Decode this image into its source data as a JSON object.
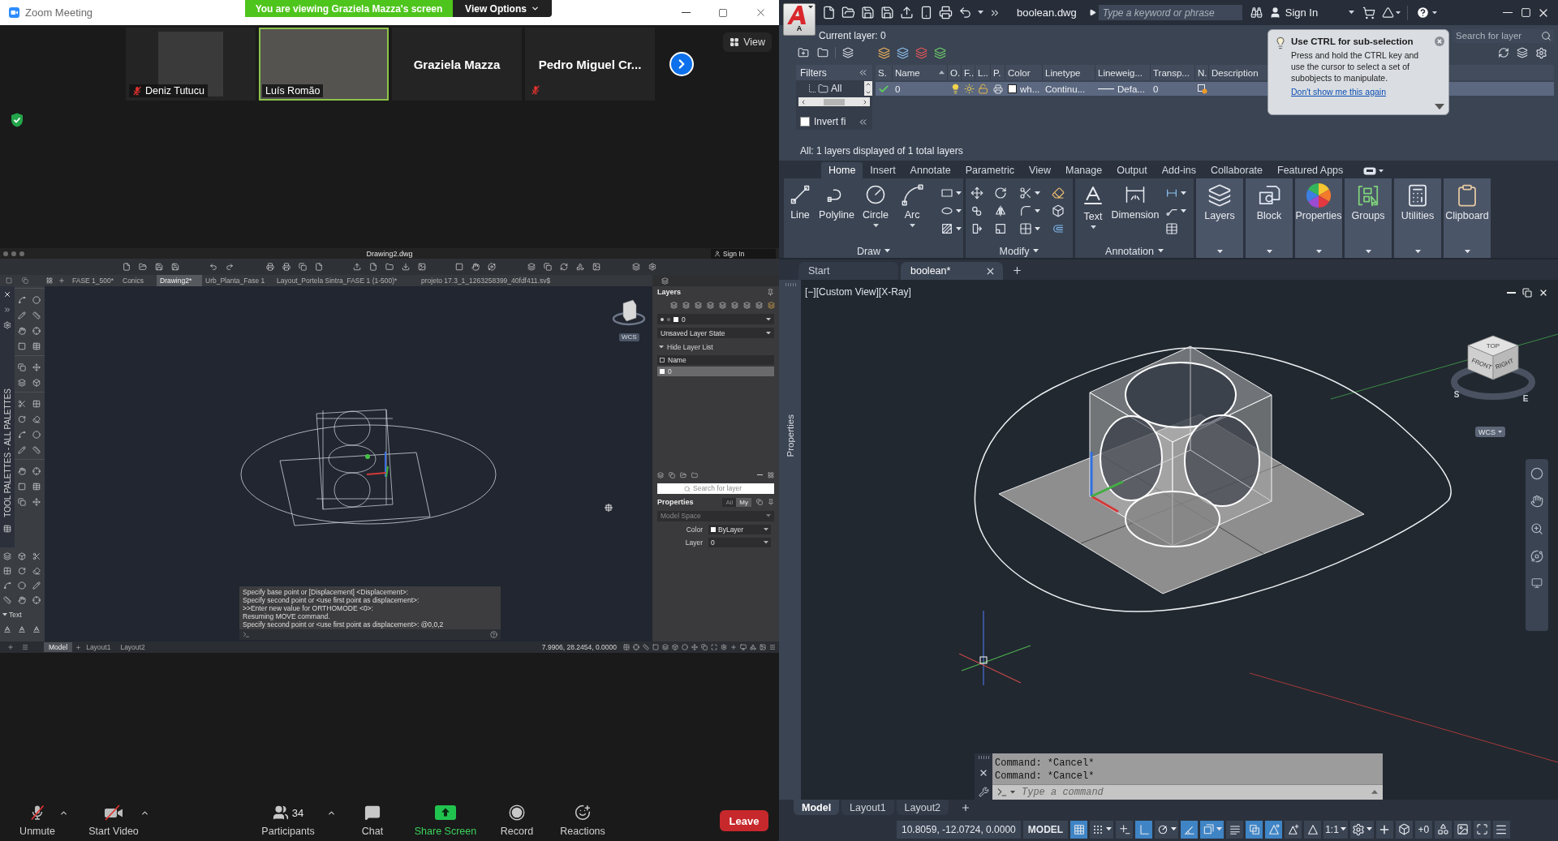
{
  "zoom": {
    "title": "Zoom Meeting",
    "banner": "You are viewing Graziela Mazza's screen",
    "view_options": "View Options",
    "participants": [
      {
        "name": "Deniz Tutucu",
        "kind": "picture",
        "muted": true,
        "speaking": false
      },
      {
        "name": "Luís Romão",
        "kind": "video",
        "muted": false,
        "speaking": true
      },
      {
        "name": "Graziela Mazza",
        "kind": "name",
        "muted": false,
        "speaking": false
      },
      {
        "name": "Pedro Miguel Cr...",
        "kind": "name",
        "muted": true,
        "speaking": false
      }
    ],
    "view_button": "View",
    "shared_screen": {
      "title": "Drawing2.dwg",
      "sign_in": "Sign In",
      "file_tabs": [
        {
          "label": "FASE 1_500*",
          "selected": false
        },
        {
          "label": "Conics",
          "selected": false
        },
        {
          "label": "Drawing2*",
          "selected": true
        },
        {
          "label": "Urb_Planta_Fase 1",
          "selected": false
        },
        {
          "label": "Layout_Portela Sintra_FASE 1 (1-500)*",
          "selected": false
        },
        {
          "label": "projeto 17.3_1_1263258399_40fdf411.sv$",
          "selected": false
        }
      ],
      "palette_title": "TOOL PALETTES - ALL PALETTES",
      "palette_section": "Text",
      "layers_panel": {
        "title": "Layers",
        "current_layer": "0",
        "layer_state": "Unsaved Layer State",
        "hide_list": "Hide Layer List",
        "name_column": "Name",
        "rows": [
          {
            "name": "0",
            "selected": true
          }
        ],
        "search_placeholder": "Search for layer"
      },
      "properties_panel": {
        "title": "Properties",
        "tabs": [
          {
            "label": "All",
            "selected": false
          },
          {
            "label": "My",
            "selected": true
          }
        ],
        "context": "Model Space",
        "rows": [
          {
            "label": "Color",
            "value": "ByLayer",
            "kind": "color"
          },
          {
            "label": "Layer",
            "value": "0",
            "kind": "text"
          }
        ]
      },
      "wcs": "WCS",
      "command_history": [
        "Specify base point or [Displacement] <Displacement>:",
        "Specify second point or <use first point as displacement>:",
        ">>Enter new value for ORTHOMODE <0>:",
        "Resuming MOVE command.",
        "Specify second point or <use first point as displacement>: @0,0,2"
      ],
      "layout_tabs": [
        {
          "label": "Model",
          "selected": true
        },
        {
          "label": "Layout1",
          "selected": false
        },
        {
          "label": "Layout2",
          "selected": false
        }
      ],
      "coordinates": "7.9906, 28.2454, 0.0000"
    },
    "toolbar": [
      {
        "kind": "mute",
        "label": "Unmute",
        "menu": true
      },
      {
        "kind": "video",
        "label": "Start Video",
        "menu": true
      },
      {
        "kind": "participants",
        "label": "Participants",
        "count": "34",
        "menu": true
      },
      {
        "kind": "chat",
        "label": "Chat",
        "menu": false
      },
      {
        "kind": "share",
        "label": "Share Screen",
        "menu": false
      },
      {
        "kind": "record",
        "label": "Record",
        "menu": false
      },
      {
        "kind": "reactions",
        "label": "Reactions",
        "menu": false
      }
    ],
    "leave": "Leave"
  },
  "autocad": {
    "app_menu_label": "A",
    "file_name": "boolean.dwg",
    "search_placeholder": "Type a keyword or phrase",
    "sign_in": "Sign In",
    "layer_manager": {
      "current_layer": "Current layer: 0",
      "search_placeholder": "Search for layer",
      "filters_title": "Filters",
      "filters": [
        "All"
      ],
      "invert_filter": {
        "label": "Invert fi",
        "checked": false
      },
      "columns": [
        "S.",
        "Name",
        "O.",
        "F..",
        "L..",
        "P.",
        "Color",
        "Linetype",
        "Lineweig...",
        "Transp...",
        "N.",
        "Description"
      ],
      "rows": [
        {
          "current": true,
          "name": "0",
          "on": true,
          "frozen": false,
          "locked": false,
          "color": "#ffffff",
          "color_name": "wh...",
          "linetype": "Continu...",
          "lineweight": "Defa...",
          "transparency": "0",
          "selected": true
        }
      ],
      "summary": "All: 1 layers displayed of 1 total layers"
    },
    "tooltip": {
      "title": "Use CTRL for sub-selection",
      "body": "Press and hold the CTRL key and use the cursor to select a set of subobjects to manipulate.",
      "link": "Don't show me this again"
    },
    "ribbon_tabs": [
      {
        "label": "Home",
        "selected": true
      },
      {
        "label": "Insert",
        "selected": false
      },
      {
        "label": "Annotate",
        "selected": false
      },
      {
        "label": "Parametric",
        "selected": false
      },
      {
        "label": "View",
        "selected": false
      },
      {
        "label": "Manage",
        "selected": false
      },
      {
        "label": "Output",
        "selected": false
      },
      {
        "label": "Add-ins",
        "selected": false
      },
      {
        "label": "Collaborate",
        "selected": false
      },
      {
        "label": "Featured Apps",
        "selected": false
      }
    ],
    "ribbon_panels": [
      {
        "kind": "draw",
        "title": "Draw",
        "tools": [
          {
            "kind": "line",
            "label": "Line",
            "menu": false
          },
          {
            "kind": "polyline",
            "label": "Polyline",
            "menu": false
          },
          {
            "kind": "circle",
            "label": "Circle",
            "menu": true
          },
          {
            "kind": "arc",
            "label": "Arc",
            "menu": true
          }
        ]
      },
      {
        "kind": "modify",
        "title": "Modify"
      },
      {
        "kind": "annotation",
        "title": "Annotation",
        "tools": [
          {
            "kind": "text",
            "label": "Text",
            "menu": true
          },
          {
            "kind": "dimension",
            "label": "Dimension",
            "menu": false
          }
        ]
      }
    ],
    "ribbon_buttons": [
      {
        "kind": "layers",
        "label": "Layers"
      },
      {
        "kind": "block",
        "label": "Block"
      },
      {
        "kind": "properties",
        "label": "Properties"
      },
      {
        "kind": "groups",
        "label": "Groups"
      },
      {
        "kind": "utilities",
        "label": "Utilities"
      },
      {
        "kind": "clipboard",
        "label": "Clipboard"
      }
    ],
    "doc_tabs": [
      {
        "label": "Start",
        "selected": false
      },
      {
        "label": "boolean*",
        "selected": true
      }
    ],
    "viewport": {
      "label": "[−][Custom View][X-Ray]",
      "side_palette": "Properties",
      "viewcube": {
        "faces": [
          "TOP",
          "FRONT",
          "RIGHT"
        ],
        "compass": [
          "S",
          "E"
        ],
        "wcs": "WCS"
      }
    },
    "command_line": {
      "history": [
        "Command: *Cancel*",
        "Command: *Cancel*"
      ],
      "placeholder": "Type a command"
    },
    "layout_tabs": [
      {
        "label": "Model",
        "selected": true
      },
      {
        "label": "Layout1",
        "selected": false
      },
      {
        "label": "Layout2",
        "selected": false
      }
    ],
    "status_bar": {
      "coordinates": "10.8059, -12.0724, 0.0000",
      "space": "MODEL",
      "toggles": [
        {
          "kind": "grid",
          "on": true,
          "menu": false
        },
        {
          "kind": "snap",
          "on": false,
          "menu": true
        },
        {
          "kind": "ortho",
          "on": false,
          "menu": false
        },
        {
          "kind": "polar",
          "on": true,
          "menu": false
        },
        {
          "kind": "isodraft",
          "on": false,
          "menu": true
        },
        {
          "kind": "osnap",
          "on": true,
          "menu": false
        },
        {
          "kind": "object",
          "on": true,
          "menu": true
        },
        {
          "kind": "lineweight",
          "on": false,
          "menu": false
        },
        {
          "kind": "transparency",
          "on": true,
          "menu": false
        },
        {
          "kind": "annotation",
          "on": true,
          "menu": false
        },
        {
          "kind": "autoscale",
          "on": false,
          "menu": false
        },
        {
          "kind": "visibility",
          "on": false,
          "menu": false
        }
      ],
      "scale": "1:1",
      "isolate_count": "+0"
    }
  }
}
